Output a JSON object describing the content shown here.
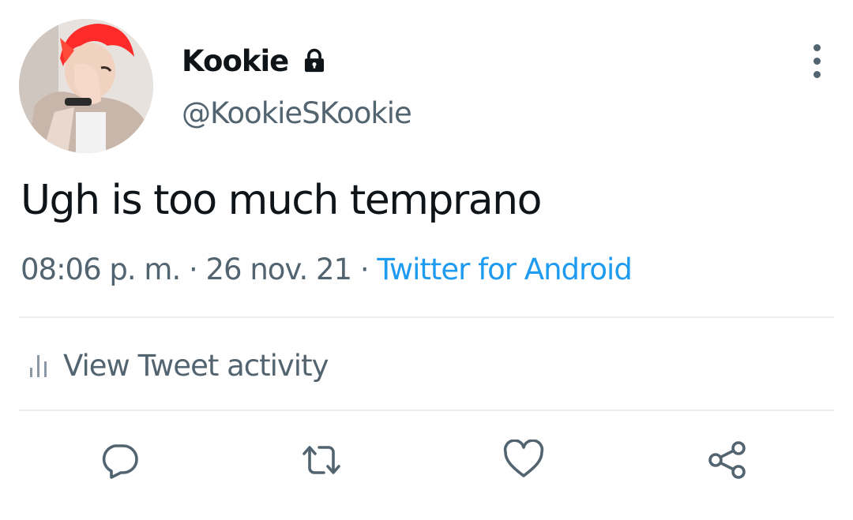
{
  "tweet": {
    "author": {
      "display_name": "Kookie",
      "handle": "@KookieSKookie",
      "protected_icon": "lock-icon"
    },
    "text": "Ugh is too much temprano",
    "time": "08:06 p. m.",
    "separator": "·",
    "date": "26 nov. 21",
    "source": "Twitter for Android"
  },
  "activity": {
    "icon": "bar-chart-icon",
    "label": "View Tweet activity"
  },
  "actions": {
    "icons": [
      "reply-icon",
      "retweet-icon",
      "like-icon",
      "share-icon"
    ]
  },
  "colors": {
    "text_primary": "#0f1419",
    "text_secondary": "#536471",
    "accent": "#1d9bf0",
    "divider": "#eceff1",
    "avatar_hair": "#ff2b2b"
  }
}
